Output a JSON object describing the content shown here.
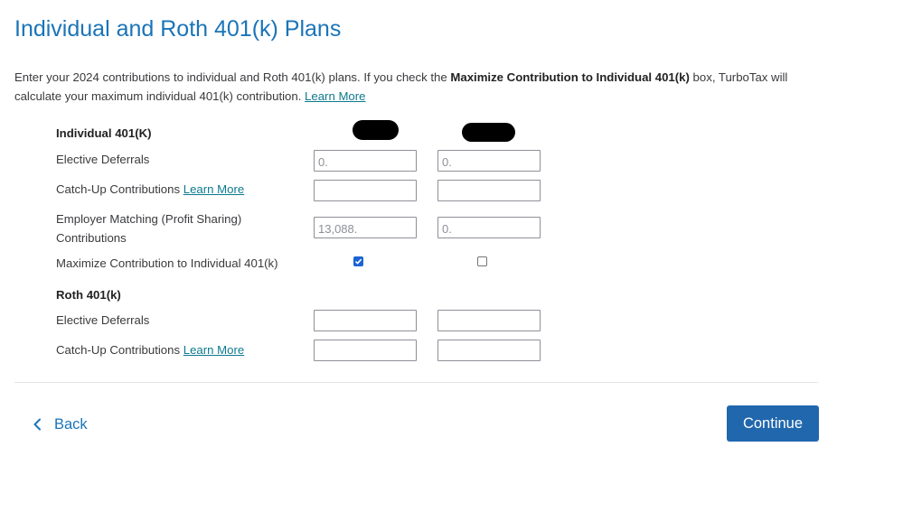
{
  "page": {
    "title": "Individual and Roth 401(k) Plans",
    "intro_part1": "Enter your 2024 contributions to individual and Roth 401(k) plans. If you check the ",
    "intro_bold": "Maximize Contribution to Individual 401(k)",
    "intro_part2": " box, TurboTax will calculate your maximum individual 401(k) contribution. ",
    "intro_link": "Learn More"
  },
  "individual": {
    "heading": "Individual 401(K)",
    "elective_label": "Elective Deferrals",
    "elective_col1": "0.",
    "elective_col2": "0.",
    "catchup_label": "Catch-Up Contributions",
    "catchup_link": "Learn More",
    "catchup_col1": "",
    "catchup_col2": "",
    "employer_label_line1": "Employer Matching (Profit Sharing)",
    "employer_label_line2": "Contributions",
    "employer_col1": "13,088.",
    "employer_col2": "0.",
    "maximize_label": "Maximize Contribution to Individual 401(k)",
    "maximize_col1_checked": true,
    "maximize_col2_checked": false
  },
  "roth": {
    "heading": "Roth 401(k)",
    "elective_label": "Elective Deferrals",
    "elective_col1": "",
    "elective_col2": "",
    "catchup_label": "Catch-Up Contributions",
    "catchup_link": "Learn More",
    "catchup_col1": "",
    "catchup_col2": ""
  },
  "nav": {
    "back_label": "Back",
    "continue_label": "Continue"
  },
  "colors": {
    "title": "#1a74b8",
    "link": "#0d7a8e",
    "continue_bg": "#2167ad",
    "checkbox_checked": "#1a64d3"
  },
  "icons": {
    "back": "chevron-left-icon",
    "check": "checkmark-icon"
  }
}
